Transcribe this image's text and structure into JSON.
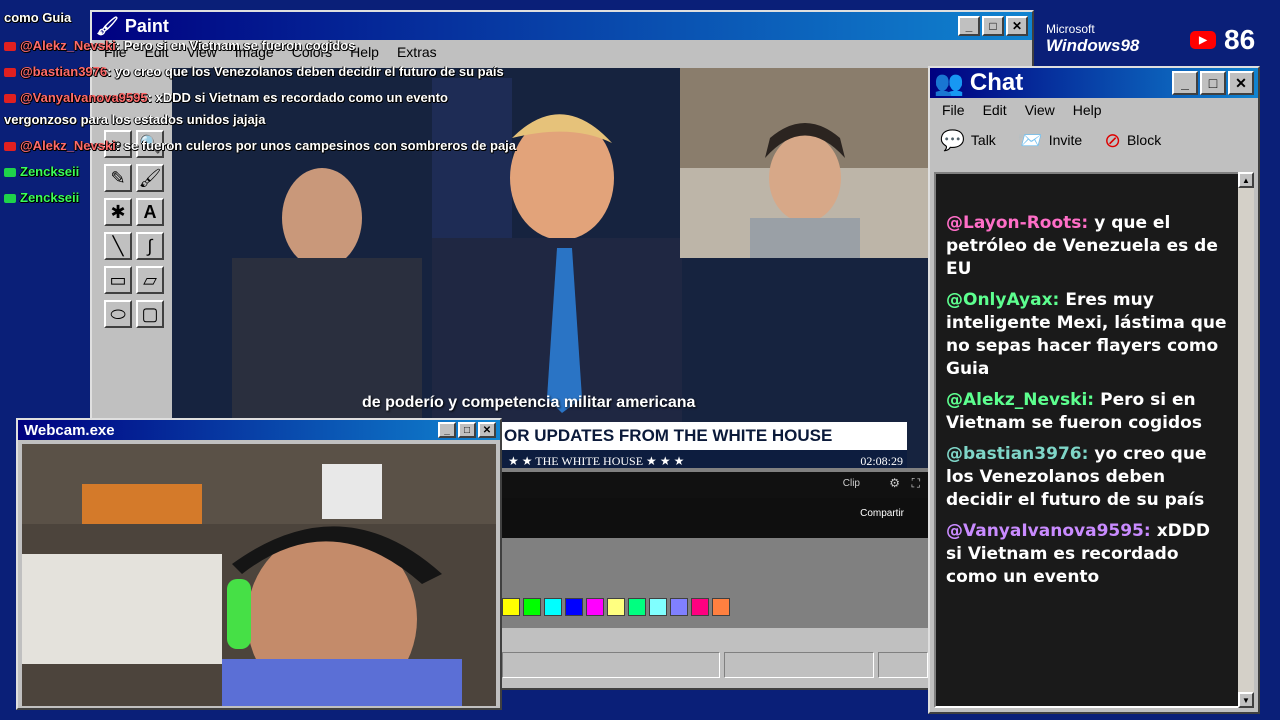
{
  "overlay_chat": [
    {
      "user": "@Alekz_Nevski",
      "text": ": Pero si en Vietnam se fueron cogidos",
      "color": "red"
    },
    {
      "user": "@bastian3976",
      "text": ": yo creo que los Venezolanos deben decidir el futuro de su país",
      "color": "red"
    },
    {
      "user": "@VanyaIvanova9595",
      "text": ": xDDD si Vietnam es recordado como un evento",
      "color": "red"
    },
    {
      "user": "",
      "text": "vergonzoso para los estados unidos jajaja",
      "color": "none"
    },
    {
      "user": "@Alekz_Nevski",
      "text": ": se fueron culeros por unos campesinos con sombreros de paja",
      "color": "red"
    },
    {
      "user": "Zenckseii",
      "text": "",
      "color": "green"
    },
    {
      "user": "Zenckseii",
      "text": "",
      "color": "green"
    }
  ],
  "overlay_top_fragment": "como Guia",
  "paint": {
    "title": "Paint",
    "menu": [
      "File",
      "Edit",
      "View",
      "Image",
      "Colors",
      "Help",
      "Extras"
    ],
    "video_subtitle": "de poderío y competencia militar americana",
    "banner_title": "OR UPDATES FROM THE WHITE HOUSE",
    "banner_sub": "★ ★   THE WHITE HOUSE   ★ ★ ★",
    "time": "02:08:29",
    "clip_label": "Clip",
    "share_label": "Compartir",
    "palette": [
      "#ffff00",
      "#00ff00",
      "#00ffff",
      "#0000ff",
      "#ff00ff",
      "#ffff80",
      "#00ff80",
      "#80ffff",
      "#8080ff",
      "#ff0080",
      "#ff8040"
    ]
  },
  "webcam": {
    "title": "Webcam.exe"
  },
  "chat": {
    "title": "Chat",
    "menu": [
      "File",
      "Edit",
      "View",
      "Help"
    ],
    "toolbar": [
      {
        "label": "Talk",
        "icon": "talk-icon"
      },
      {
        "label": "Invite",
        "icon": "invite-icon"
      },
      {
        "label": "Block",
        "icon": "block-icon"
      }
    ],
    "messages": [
      {
        "user": "@Layon-Roots:",
        "text": "y que el petróleo de Venezuela es de EU",
        "color": "#ff6ec7"
      },
      {
        "user": "@OnlyAyax:",
        "text": "Eres muy inteligente Mexi, lástima que no sepas hacer flayers como Guia",
        "color": "#5dff8f"
      },
      {
        "user": "@Alekz_Nevski:",
        "text": "Pero si en Vietnam se fueron cogidos",
        "color": "#5dff8f"
      },
      {
        "user": "@bastian3976:",
        "text": "yo creo que los Venezolanos deben decidir el futuro de su país",
        "color": "#7fd6c8"
      },
      {
        "user": "@VanyaIvanova9595:",
        "text": "xDDD si Vietnam es recordado como un evento",
        "color": "#c98bff"
      }
    ]
  },
  "brand": {
    "microsoft": "Microsoft",
    "windows": "Windows98"
  },
  "viewers": "86"
}
